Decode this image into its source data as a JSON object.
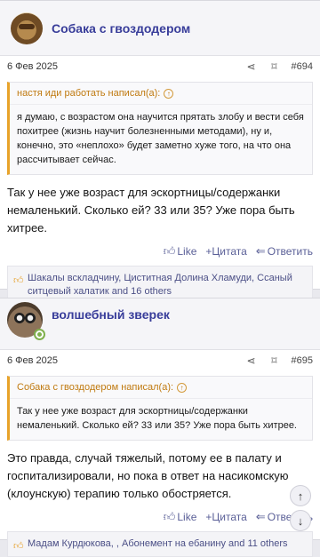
{
  "post1": {
    "author": "Собака с гвоздодером",
    "date": "6 Фев 2025",
    "number": "#694",
    "quote_header": "настя иди работать написал(а):",
    "quote_text": "я думаю, с возрастом она научится прятать злобу и вести себя похитрее (жизнь научит болезненными методами), ну и, конечно, это «неплохо» будет заметно хуже того, на что она рассчитывает сейчас.",
    "message": "Так у нее уже возраст для эскортницы/содержанки немаленький. Сколько ей? 33 или 35? Уже пора быть хитрее.",
    "actions": {
      "like": "Like",
      "quote": "+Цитата",
      "reply": "Ответить"
    },
    "likes_text": "Шакалы вскладчину, Циститная Долина Хламуди, Ссаный ситцевый халатик and 16 others"
  },
  "post2": {
    "author": "волшебный зверек",
    "date": "6 Фев 2025",
    "number": "#695",
    "quote_header": "Собака с гвоздодером написал(а):",
    "quote_text": "Так у нее уже возраст для эскортницы/содержанки немаленький. Сколько ей? 33 или 35? Уже пора быть хитрее.",
    "message": "Это правда, случай тяжелый, потому ее в палату и госпитализировали, но пока в ответ на насикомскую (клоунскую) терапию только обостряется.",
    "actions": {
      "like": "Like",
      "quote": "+Цитата",
      "reply": "Ответить"
    },
    "likes_text": "Мадам Курдюкова,      , Абонемент на ебанину and 11 others"
  },
  "icons": {
    "share": "share-icon",
    "bookmark": "bookmark-icon",
    "thumb": "thumb-up-icon",
    "arrow_up": "arrow-up-icon",
    "arrow_down": "arrow-down-icon"
  },
  "colors": {
    "author": "#383d9a",
    "quote_accent": "#e8a32a",
    "link": "#5a5f97",
    "online": "#7fb04c"
  }
}
